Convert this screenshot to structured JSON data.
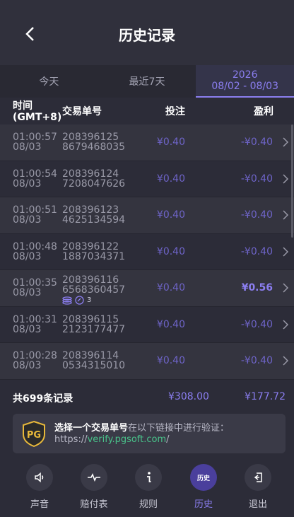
{
  "header": {
    "title": "历史记录"
  },
  "tabs": [
    {
      "label": "今天",
      "sub": ""
    },
    {
      "label": "最近7天",
      "sub": ""
    },
    {
      "label": "2026",
      "sub": "08/02 - 08/03"
    }
  ],
  "columns": {
    "time": "时间",
    "tz": "(GMT+8)",
    "txid": "交易单号",
    "bet": "投注",
    "profit": "盈利"
  },
  "rows": [
    {
      "time": "01:00:57",
      "date": "08/03",
      "tx1": "208396125",
      "tx2": "8679468035",
      "bet": "¥0.40",
      "profit": "-¥0.40"
    },
    {
      "time": "01:00:54",
      "date": "08/03",
      "tx1": "208396124",
      "tx2": "7208047626",
      "bet": "¥0.40",
      "profit": "-¥0.40"
    },
    {
      "time": "01:00:51",
      "date": "08/03",
      "tx1": "208396123",
      "tx2": "4625134594",
      "bet": "¥0.40",
      "profit": "-¥0.40"
    },
    {
      "time": "01:00:48",
      "date": "08/03",
      "tx1": "208396122",
      "tx2": "1887034371",
      "bet": "¥0.40",
      "profit": "-¥0.40"
    },
    {
      "time": "01:00:35",
      "date": "08/03",
      "tx1": "208396116",
      "tx2": "6568360457",
      "bet": "¥0.40",
      "profit": "¥0.56",
      "badge_count": "3"
    },
    {
      "time": "01:00:31",
      "date": "08/03",
      "tx1": "208396115",
      "tx2": "2123177477",
      "bet": "¥0.40",
      "profit": "-¥0.40"
    },
    {
      "time": "01:00:28",
      "date": "08/03",
      "tx1": "208396114",
      "tx2": "0534315010",
      "bet": "¥0.40",
      "profit": "-¥0.40"
    }
  ],
  "summary": {
    "total": "共699条记录",
    "bet": "¥308.00",
    "profit": "¥177.72"
  },
  "verify": {
    "logo_text": "PG",
    "bold": "选择一个交易单号",
    "rest": "在以下链接中进行验证：",
    "link_prefix": "https://",
    "link_host": "verify.pgsoft.com",
    "link_suffix": "/"
  },
  "footer": [
    {
      "label": "声音",
      "icon": "speaker-icon"
    },
    {
      "label": "赔付表",
      "icon": "pulse-icon"
    },
    {
      "label": "规则",
      "icon": "info-icon"
    },
    {
      "label": "历史",
      "icon": "history-icon",
      "inner": "历史"
    },
    {
      "label": "退出",
      "icon": "exit-icon"
    }
  ],
  "colors": {
    "accent": "#8b7ef0",
    "link": "#49c28a",
    "bg": "#2c2c38"
  }
}
